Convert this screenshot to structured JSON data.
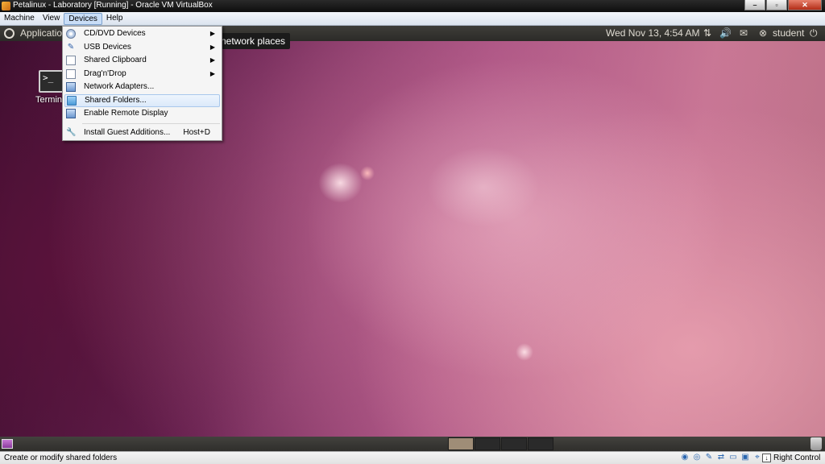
{
  "window": {
    "title": "Petalinux - Laboratory [Running] - Oracle VM VirtualBox",
    "controls": {
      "minimize": "–",
      "maximize": "▫",
      "close": "✕"
    }
  },
  "menubar": {
    "items": [
      {
        "label": "Machine"
      },
      {
        "label": "View"
      },
      {
        "label": "Devices",
        "active": true
      },
      {
        "label": "Help"
      }
    ]
  },
  "guest": {
    "top_panel": {
      "applications": "Applications",
      "clock": "Wed Nov 13,  4:54 AM",
      "user": "student",
      "icons": [
        "network-icon",
        "volume-icon",
        "mail-icon",
        "close-circle-icon",
        "power-icon"
      ]
    },
    "tooltip": "network places",
    "desktop_icon": {
      "label": "Terminal",
      "glyph": ">_"
    }
  },
  "devices_menu": {
    "items": [
      {
        "label": "CD/DVD Devices",
        "icon": "cd-icon",
        "submenu": true
      },
      {
        "label": "USB Devices",
        "icon": "usb-icon",
        "submenu": true
      },
      {
        "label": "Shared Clipboard",
        "icon": "clipboard-icon",
        "submenu": true
      },
      {
        "label": "Drag'n'Drop",
        "icon": "drag-drop-icon",
        "submenu": true
      },
      {
        "label": "Network Adapters...",
        "icon": "network-adapter-icon"
      },
      {
        "label": "Shared Folders...",
        "icon": "shared-folder-icon",
        "hovered": true
      },
      {
        "label": "Enable Remote Display",
        "icon": "remote-display-icon"
      },
      {
        "label": "Install Guest Additions...",
        "icon": "guest-additions-icon",
        "shortcut": "Host+D"
      }
    ]
  },
  "statusbar": {
    "text": "Create or modify shared folders",
    "host_key": "Right Control"
  }
}
